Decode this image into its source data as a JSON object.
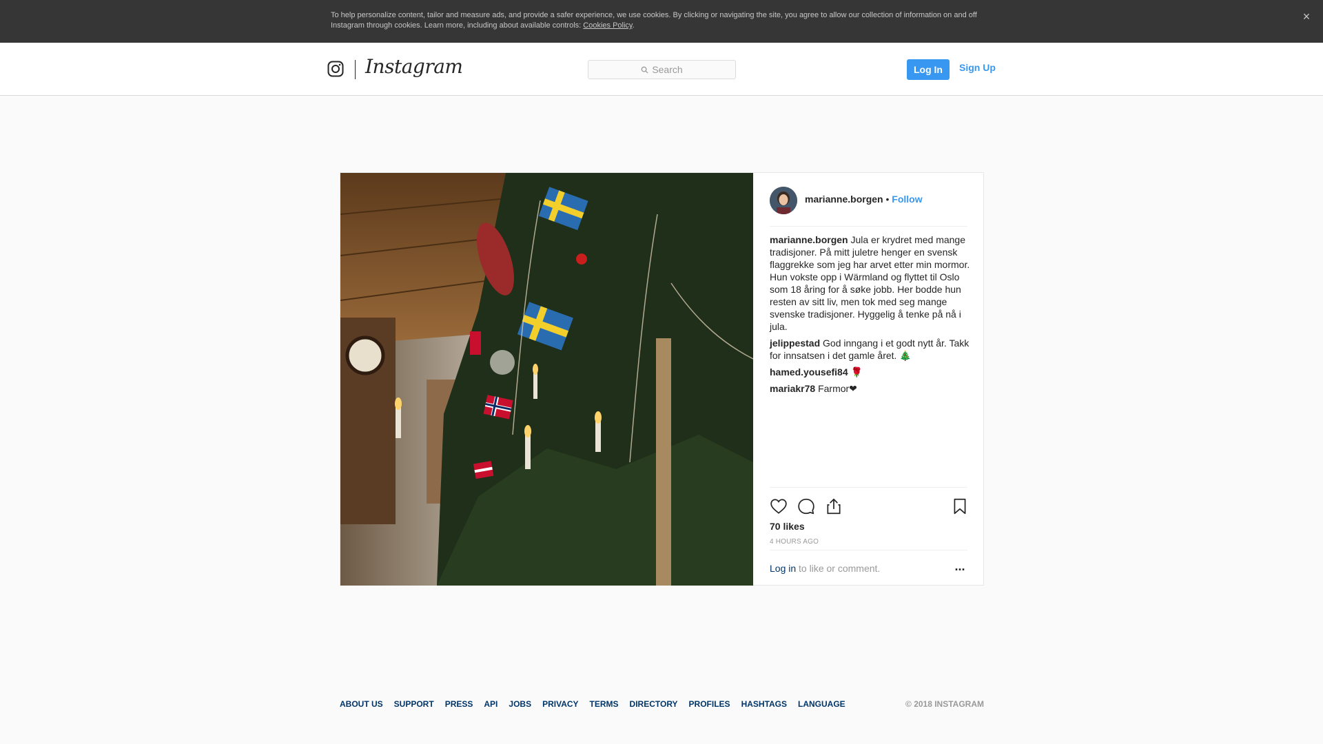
{
  "cookie_banner": {
    "text": "To help personalize content, tailor and measure ads, and provide a safer experience, we use cookies. By clicking or navigating the site, you agree to allow our collection of information on and off Instagram through cookies. Learn more, including about available controls: ",
    "link": "Cookies Policy",
    "link_suffix": ".",
    "close_icon": "×"
  },
  "nav": {
    "logo_icon": "instagram-glyph-icon",
    "wordmark": "Instagram",
    "search_placeholder": "Search",
    "login_label": "Log In",
    "signup_label": "Sign Up",
    "accent_color": "#3897f0"
  },
  "post": {
    "author": "marianne.borgen",
    "separator": "•",
    "follow_label": "Follow",
    "caption": {
      "user": "marianne.borgen",
      "text": "Jula er krydret med mange tradisjoner. På mitt juletre henger en svensk flaggrekke som jeg har arvet etter min mormor. Hun vokste opp i Wärmland og flyttet til Oslo som 18 åring for å søke jobb. Her bodde hun resten av sitt liv, men tok med seg mange svenske tradisjoner. Hyggelig å tenke på nå i jula."
    },
    "comments": [
      {
        "user": "jelippestad",
        "text": "God inngang i et godt nytt år. Takk for innsatsen i det gamle året. 🎄"
      },
      {
        "user": "hamed.yousefi84",
        "text": "🌹"
      },
      {
        "user": "mariakr78",
        "text": "Farmor❤"
      }
    ],
    "likes": "70 likes",
    "time_ago": "4 HOURS AGO",
    "login_link": "Log in",
    "login_suffix": " to like or comment.",
    "more_label": "...",
    "icons": [
      "heart-icon",
      "comment-icon",
      "share-icon",
      "bookmark-icon"
    ]
  },
  "footer": {
    "links": [
      "ABOUT US",
      "SUPPORT",
      "PRESS",
      "API",
      "JOBS",
      "PRIVACY",
      "TERMS",
      "DIRECTORY",
      "PROFILES",
      "HASHTAGS",
      "LANGUAGE"
    ],
    "copyright": "© 2018 INSTAGRAM"
  }
}
